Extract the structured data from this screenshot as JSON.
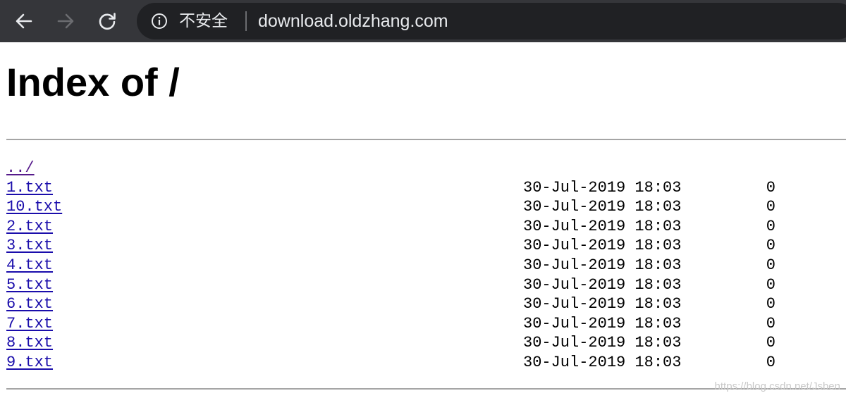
{
  "browser": {
    "security_label": "不安全",
    "url": "download.oldzhang.com",
    "icons": {
      "back": "back-arrow-icon",
      "forward": "forward-arrow-icon",
      "reload": "reload-icon",
      "info": "info-icon"
    },
    "colors": {
      "toolbar": "#35363a",
      "omnibox": "#202124",
      "text": "#e8eaed",
      "forward_disabled": "#6b6c70"
    }
  },
  "page": {
    "title": "Index of /",
    "parent_link": "../",
    "files": [
      {
        "name": "1.txt",
        "date": "30-Jul-2019 18:03",
        "size": "0"
      },
      {
        "name": "10.txt",
        "date": "30-Jul-2019 18:03",
        "size": "0"
      },
      {
        "name": "2.txt",
        "date": "30-Jul-2019 18:03",
        "size": "0"
      },
      {
        "name": "3.txt",
        "date": "30-Jul-2019 18:03",
        "size": "0"
      },
      {
        "name": "4.txt",
        "date": "30-Jul-2019 18:03",
        "size": "0"
      },
      {
        "name": "5.txt",
        "date": "30-Jul-2019 18:03",
        "size": "0"
      },
      {
        "name": "6.txt",
        "date": "30-Jul-2019 18:03",
        "size": "0"
      },
      {
        "name": "7.txt",
        "date": "30-Jul-2019 18:03",
        "size": "0"
      },
      {
        "name": "8.txt",
        "date": "30-Jul-2019 18:03",
        "size": "0"
      },
      {
        "name": "9.txt",
        "date": "30-Jul-2019 18:03",
        "size": "0"
      }
    ],
    "colors": {
      "link": "#1a0dab",
      "visited_link": "#551a8b"
    }
  },
  "watermark": "https://blog.csdn.net/Jsben"
}
